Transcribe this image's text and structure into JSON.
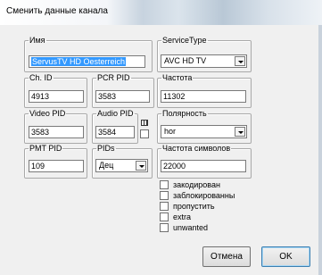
{
  "window": {
    "title": "Сменить данные канала"
  },
  "groups": {
    "name": {
      "label": "Имя",
      "value": "ServusTV HD Oesterreich"
    },
    "service_type": {
      "label": "ServiceType",
      "value": "AVC HD TV"
    },
    "ch_id": {
      "label": "Ch. ID",
      "value": "4913"
    },
    "pcr_pid": {
      "label": "PCR PID",
      "value": "3583"
    },
    "frequency": {
      "label": "Частота",
      "value": "11302"
    },
    "video_pid": {
      "label": "Video PID",
      "value": "3583"
    },
    "audio_pid": {
      "label": "Audio PID",
      "value": "3584"
    },
    "polarity": {
      "label": "Полярность",
      "value": "hor"
    },
    "pmt_pid": {
      "label": "PMT PID",
      "value": "109"
    },
    "pids": {
      "label": "PIDs",
      "value": "Дец"
    },
    "symbol_rate": {
      "label": "Частота символов",
      "value": "22000"
    }
  },
  "checkboxes": [
    {
      "label": "закодирован",
      "checked": false
    },
    {
      "label": "заблокированны",
      "checked": false
    },
    {
      "label": "пропустить",
      "checked": false
    },
    {
      "label": "extra",
      "checked": false
    },
    {
      "label": "unwanted",
      "checked": false
    }
  ],
  "buttons": {
    "cancel": "Отмена",
    "ok": "OK"
  }
}
